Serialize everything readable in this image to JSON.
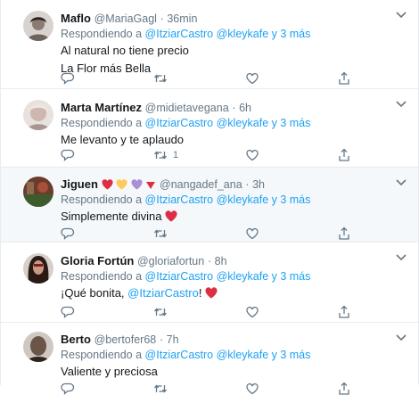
{
  "reply_prefix": "Respondiendo a",
  "tweets": [
    {
      "name": "Maflo",
      "handle": "@MariaGagl",
      "dot": "·",
      "time": "36min",
      "mentions": "@ItziarCastro @kleykafe y 3 más",
      "lines": [
        "Al natural no tiene precio",
        "La Flor más Bella"
      ],
      "retweets": "",
      "avatar_color": "#8a8a8a"
    },
    {
      "name": "Marta Martínez",
      "handle": "@midietavegana",
      "dot": "·",
      "time": "6h",
      "mentions": "@ItziarCastro @kleykafe y 3 más",
      "lines": [
        "Me levanto y te aplaudo"
      ],
      "retweets": "1",
      "avatar_color": "#b7a6a2"
    },
    {
      "name": "Jiguen",
      "name_emoji": [
        "❤",
        "💛",
        "💜"
      ],
      "name_triangle": "🔻",
      "handle": "@nangadef_ana",
      "dot": "·",
      "time": "3h",
      "mentions": "@ItziarCastro @kleykafe y 3 más",
      "lines": [
        "Simplemente divina"
      ],
      "line_emoji": "❤",
      "retweets": "",
      "avatar_color": "#7a4a3a"
    },
    {
      "name": "Gloria Fortún",
      "handle": "@gloriafortun",
      "dot": "·",
      "time": "8h",
      "mentions": "@ItziarCastro @kleykafe y 3 más",
      "text_prefix": "¡Qué bonita, ",
      "text_mention": "@ItziarCastro",
      "text_suffix": "!",
      "line_emoji": "❤",
      "retweets": "",
      "avatar_color": "#3a2a22"
    },
    {
      "name": "Berto",
      "handle": "@bertofer68",
      "dot": "·",
      "time": "7h",
      "mentions": "@ItziarCastro @kleykafe y 3 más",
      "lines": [
        "Valiente y preciosa"
      ],
      "retweets": "",
      "avatar_color": "#5a4a40"
    }
  ],
  "colors": {
    "accent": "#1da1f2",
    "muted": "#657786",
    "heart": "#e0245e",
    "divider": "#e6ecf0"
  },
  "icons": [
    "reply-icon",
    "retweet-icon",
    "like-icon",
    "share-icon",
    "caret-down-icon"
  ]
}
